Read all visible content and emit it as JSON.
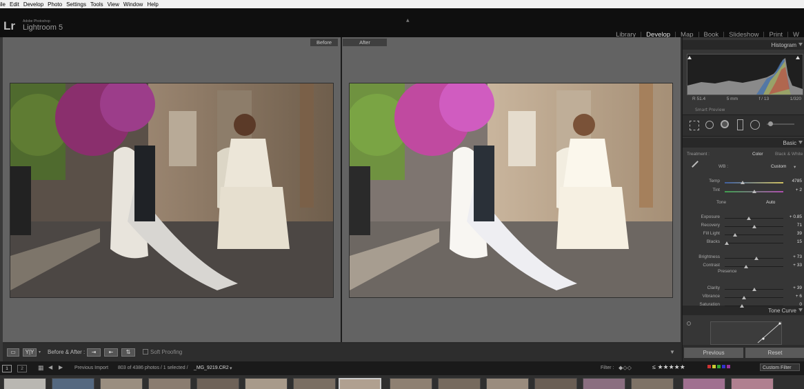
{
  "menu": [
    "ile",
    "Edit",
    "Develop",
    "Photo",
    "Settings",
    "Tools",
    "View",
    "Window",
    "Help"
  ],
  "app": {
    "logo": "Lr",
    "vendor": "Adobe Photoshop",
    "name": "Lightroom 5"
  },
  "modules": [
    {
      "label": "Library",
      "active": false
    },
    {
      "label": "Develop",
      "active": true
    },
    {
      "label": "Map",
      "active": false
    },
    {
      "label": "Book",
      "active": false
    },
    {
      "label": "Slideshow",
      "active": false
    },
    {
      "label": "Print",
      "active": false
    },
    {
      "label": "W",
      "active": false
    }
  ],
  "views": {
    "before_label": "Before",
    "after_label": "After"
  },
  "toolbar": {
    "yy": "Y|Y",
    "before_after": "Before & After :",
    "soft_proofing": "Soft Proofing"
  },
  "histogram": {
    "title": "Histogram",
    "r": "R 51.4",
    "mm": "5 mm",
    "f": "f / 13",
    "shutter": "1/320",
    "smart_preview": "Smart Preview"
  },
  "basic": {
    "title": "Basic",
    "treatment_label": "Treatment :",
    "treatment_color": "Color",
    "treatment_bw": "Black & White",
    "wb_label": "WB :",
    "wb_value": "Custom",
    "tone_label": "Tone",
    "tone_auto": "Auto",
    "presence_label": "Presence",
    "sliders": [
      {
        "label": "Temp",
        "value": "4785",
        "pos": 0.3
      },
      {
        "label": "Tint",
        "value": "+ 2",
        "pos": 0.5
      },
      {
        "label": "Exposure",
        "value": "+ 0.85",
        "pos": 0.41
      },
      {
        "label": "Recovery",
        "value": "71",
        "pos": 0.5
      },
      {
        "label": "Fill Light",
        "value": "39",
        "pos": 0.18
      },
      {
        "label": "Blacks",
        "value": "15",
        "pos": 0.04
      },
      {
        "label": "Brightness",
        "value": "+ 73",
        "pos": 0.54
      },
      {
        "label": "Contrast",
        "value": "+ 33",
        "pos": 0.36
      },
      {
        "label": "Clarity",
        "value": "+ 39",
        "pos": 0.5
      },
      {
        "label": "Vibrance",
        "value": "+ 6",
        "pos": 0.33
      },
      {
        "label": "Saturation",
        "value": "0",
        "pos": 0.29
      }
    ]
  },
  "tone_curve": {
    "title": "Tone Curve"
  },
  "buttons": {
    "previous": "Previous",
    "reset": "Reset"
  },
  "filmbar": {
    "screen1": "1",
    "screen2": "2",
    "source": "Previous Import",
    "count": "803 of 4386 photos / 1 selected /",
    "filename": "_MG_9219.CR2",
    "filter_label": "Filter :",
    "custom_filter": "Custom Filter"
  },
  "colors": {
    "accent": "#e8e8e8",
    "panel": "#363636",
    "canvas": "#636363"
  }
}
